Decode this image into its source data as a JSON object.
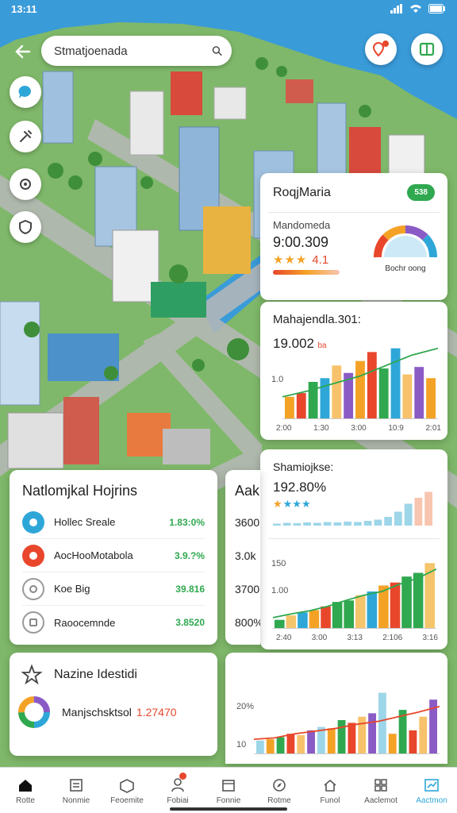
{
  "status_bar": {
    "time": "13:11"
  },
  "search": {
    "value": "Stmatjoenada"
  },
  "right_panel": {
    "title": "RoqjMaria",
    "pill": "538",
    "section1_label": "Mandomeda",
    "section1_value": "9:00.309",
    "section1_rating": "4.1",
    "gauge_label": "Bochr oong",
    "chart1_title": "Mahajendla.301:",
    "chart1_value": "19.002",
    "chart1_value_unit": "ba",
    "chart1_y_label": "1.0",
    "chart1_x_ticks": [
      "2:00",
      "1:30",
      "3:00",
      "10:9",
      "2:01"
    ],
    "section3_label": "Shamiojkse:",
    "section3_value": "192.80%",
    "chart2_y_labels": [
      "150",
      "1.00"
    ],
    "chart2_x_ticks": [
      "2:40",
      "3:00",
      "3:13",
      "2:106",
      "3:16"
    ]
  },
  "national": {
    "title": "Natlomjkal Hojrins",
    "rows": [
      {
        "label": "Hollec Sreale",
        "value": "1.83:0%",
        "icon": "map-pin-icon"
      },
      {
        "label": "AocHooMotabola",
        "value": "3.9.?%",
        "icon": "target-icon"
      },
      {
        "label": "Koe Big",
        "value": "39.816",
        "icon": "globe-icon"
      },
      {
        "label": "Raoocemnde",
        "value": "3.8520",
        "icon": "tag-icon"
      }
    ]
  },
  "middle_peek": {
    "title": "Aak",
    "rows": [
      "3600",
      "3.0k",
      "3700",
      "800%"
    ]
  },
  "bottom_left": {
    "title": "Nazine Idestidi",
    "row_label": "Manjschsktsol",
    "row_value": "1.27470"
  },
  "bottom_chart": {
    "y_labels": [
      "20%",
      "10"
    ]
  },
  "nav": {
    "items": [
      {
        "label": "Rotte",
        "icon": "home-icon"
      },
      {
        "label": "Nonmie",
        "icon": "news-icon"
      },
      {
        "label": "Feoemite",
        "icon": "box-icon"
      },
      {
        "label": "Fobiai",
        "icon": "person-icon"
      },
      {
        "label": "Fonnie",
        "icon": "calendar-icon"
      },
      {
        "label": "Rotme",
        "icon": "compass-icon"
      },
      {
        "label": "Funol",
        "icon": "house-icon"
      },
      {
        "label": "Aaclemot",
        "icon": "grid-icon"
      },
      {
        "label": "Aactmon",
        "icon": "chart-icon"
      }
    ],
    "active_index": 8
  },
  "colors": {
    "accent_green": "#2fa84f",
    "accent_blue": "#2ea7d8",
    "accent_red": "#e8472c",
    "water": "#3a9bd9",
    "grass": "#7fb86a"
  },
  "chart_data": [
    {
      "type": "bar",
      "title": "Mahajendla.301:",
      "categories": [
        "2:00",
        "1:30",
        "3:00",
        "10:9",
        "2:01"
      ],
      "values": [
        0.3,
        0.35,
        0.5,
        0.55,
        0.72,
        0.62,
        0.78,
        0.9,
        0.68,
        0.95,
        0.6,
        0.7,
        0.55
      ],
      "trend": [
        0.3,
        0.38,
        0.48,
        0.58,
        0.72,
        0.86,
        0.95
      ]
    },
    {
      "type": "bar",
      "title": "Shamiojkse:",
      "values": [
        0.12,
        0.18,
        0.22,
        0.25,
        0.3,
        0.36,
        0.38,
        0.45,
        0.5,
        0.58,
        0.62,
        0.7,
        0.75,
        0.88
      ],
      "trend": [
        0.15,
        0.2,
        0.24,
        0.3,
        0.38,
        0.45,
        0.5,
        0.6,
        0.68,
        0.8
      ]
    },
    {
      "type": "bar",
      "values": [
        0.2,
        0.22,
        0.25,
        0.3,
        0.28,
        0.35,
        0.4,
        0.38,
        0.5,
        0.46,
        0.55,
        0.6,
        0.9,
        0.3,
        0.65,
        0.35,
        0.55,
        0.8
      ],
      "trend": [
        0.22,
        0.24,
        0.3,
        0.34,
        0.38,
        0.44,
        0.48,
        0.55,
        0.62,
        0.7
      ]
    }
  ]
}
